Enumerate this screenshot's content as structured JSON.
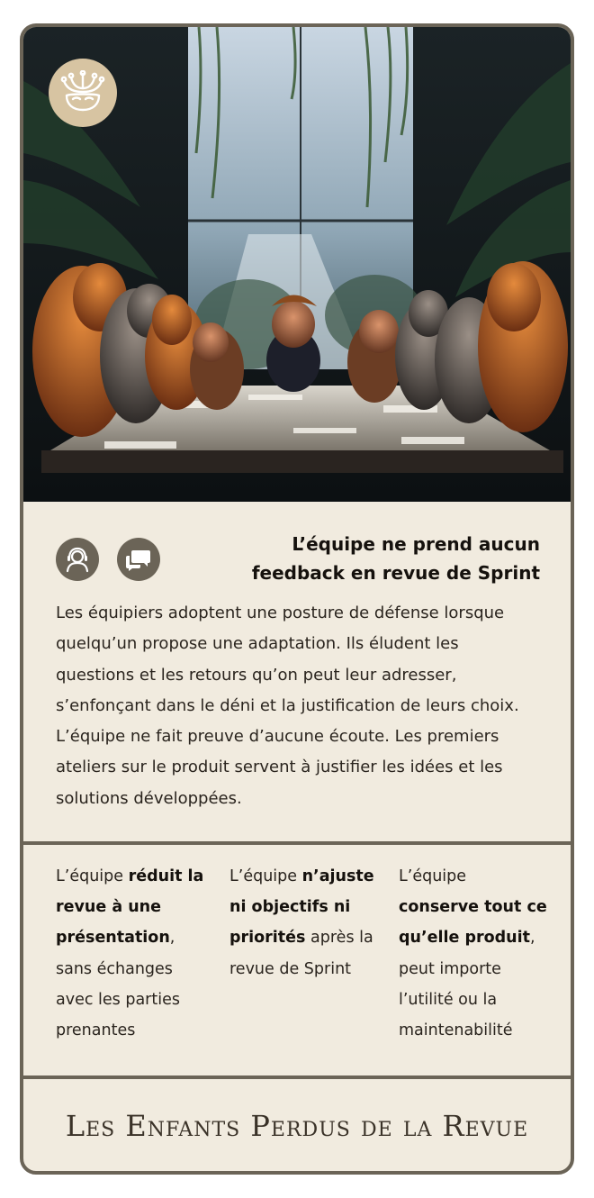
{
  "card": {
    "title": "L’équipe ne prend aucun feedback en revue de Sprint",
    "description": "Les équipiers adoptent une posture de défense lorsque quelqu’un propose une adaptation. Ils éludent les questions et les retours qu’on peut leur adresser, s’enfonçant dans le déni et la justification de leurs choix. L’équipe ne fait preuve d’aucune écoute. Les premiers ateliers sur le produit servent à justifier les idées et les solutions développées.",
    "symptoms": [
      {
        "pre": "L’équipe ",
        "bold": "réduit la revue à une présentation",
        "post": ", sans échanges avec les parties prenantes"
      },
      {
        "pre": "L’équipe ",
        "bold": "n’ajuste ni objectifs ni priorités",
        "post": " après la revue de Sprint"
      },
      {
        "pre": "L’équipe ",
        "bold": "conserve tout ce qu’elle produit",
        "post": ", peut importe l’utilité ou la maintenabilité"
      }
    ],
    "footer": "Les Enfants Perdus de la Revue",
    "icons": [
      "jester-mask-icon",
      "user-headset-icon",
      "chat-bubbles-icon"
    ],
    "colors": {
      "card_background": "#f1ebdf",
      "border": "#6b6457",
      "emblem": "#d7c4a2",
      "text": "#15110d"
    }
  }
}
